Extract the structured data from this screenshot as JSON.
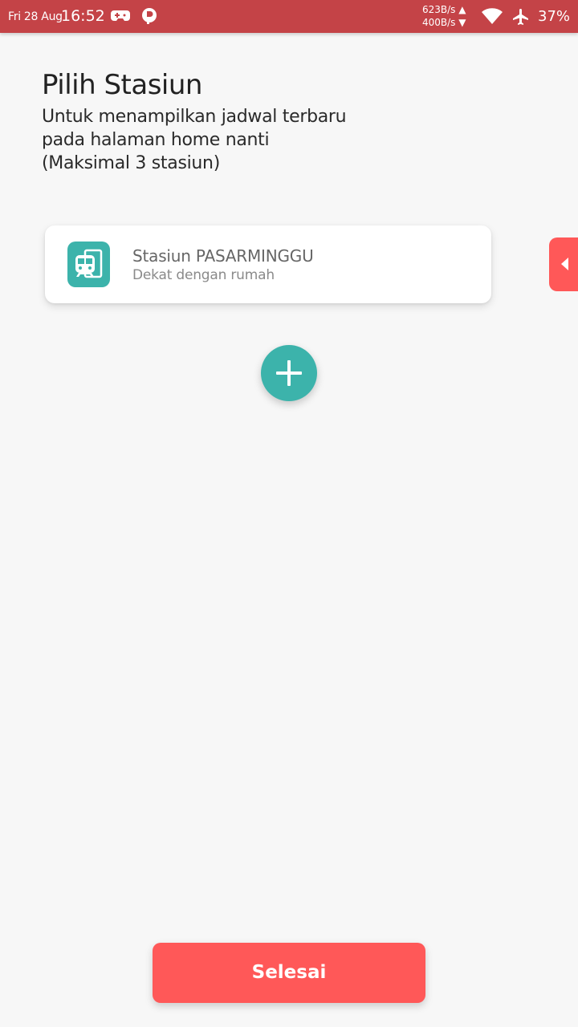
{
  "status_bar": {
    "date": "Fri 28 Aug",
    "time": "16:52",
    "upload_speed": "623B/s",
    "download_speed": "400B/s",
    "battery": "37%",
    "background_color": "#c44347",
    "icons": [
      "gamepad-icon",
      "p-icon",
      "upload-arrow-icon",
      "download-arrow-icon",
      "wifi-icon",
      "airplane-mode-icon"
    ]
  },
  "header": {
    "title": "Pilih Stasiun",
    "subtitle_lines": [
      "Untuk menampilkan jadwal terbaru",
      "pada halaman home nanti",
      "(Maksimal 3 stasiun)"
    ]
  },
  "stations": [
    {
      "name": "Stasiun PASARMINGGU",
      "note": "Dekat dengan rumah",
      "icon": "train-station-icon"
    }
  ],
  "add_button": {
    "icon": "plus-icon"
  },
  "side_tab": {
    "icon": "caret-left-icon"
  },
  "footer": {
    "done_label": "Selesai"
  },
  "colors": {
    "accent_teal": "#3cb3ab",
    "accent_red": "#ff5858",
    "background": "#f7f7f7"
  }
}
